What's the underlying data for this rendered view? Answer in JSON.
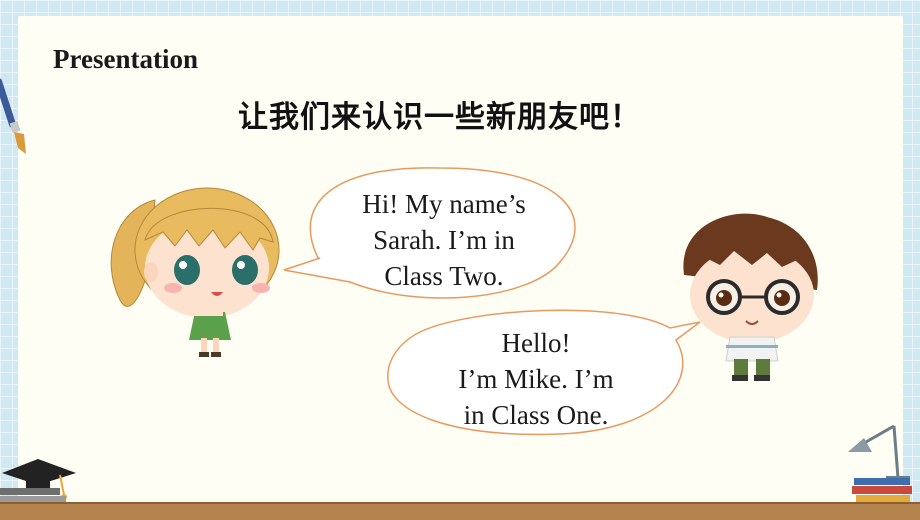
{
  "slide": {
    "title": "Presentation",
    "subtitle": "让我们来认识一些新朋友吧！"
  },
  "bubbles": {
    "sarah": {
      "lines": [
        "Hi! My name’s",
        "Sarah. I’m in",
        "Class Two."
      ]
    },
    "mike": {
      "lines": [
        "Hello!",
        "I’m Mike. I’m",
        "in Class One."
      ]
    }
  },
  "colors": {
    "background": "#cfe9f3",
    "board": "#fffef4",
    "bubble_border": "#e89a5e",
    "shelf": "#b5834e"
  },
  "icons": [
    "paintbrush-icon",
    "graduation-cap-icon",
    "book-stack-icon",
    "desk-lamp-icon"
  ]
}
